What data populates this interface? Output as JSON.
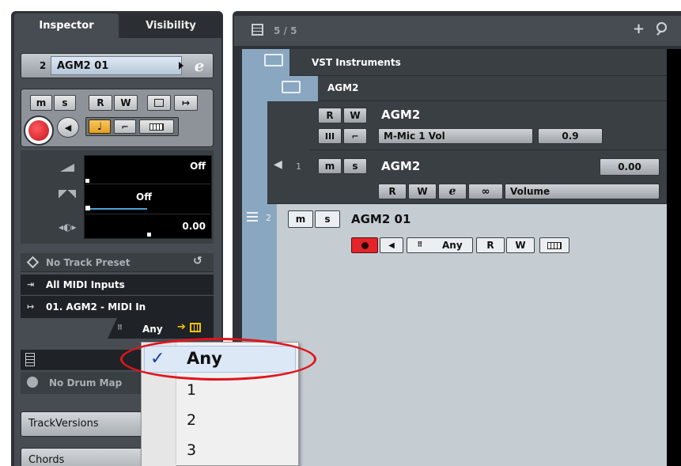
{
  "inspector": {
    "tab_inspector": "Inspector",
    "tab_visibility": "Visibility",
    "track_number": "2",
    "track_name": "AGM2 01",
    "buttons": {
      "mute": "m",
      "solo": "s",
      "read": "R",
      "write": "W"
    },
    "volume_value": "Off",
    "pan_value": "Off",
    "delay_value": "0.00",
    "track_preset": "No Track Preset",
    "midi_input": "All MIDI Inputs",
    "midi_output": "01. AGM2 - MIDI In",
    "channel": "Any",
    "drum_map": "No Drum Map",
    "section_trackversions": "TrackVersions",
    "section_chords": "Chords"
  },
  "dropdown": {
    "options": [
      "Any",
      "1",
      "2",
      "3"
    ],
    "selected": "Any"
  },
  "project": {
    "track_count": "5 / 5",
    "folder_vst": "VST Instruments",
    "folder_agm2": "AGM2",
    "instrument_track": {
      "name": "AGM2",
      "param_name": "M-Mic 1 Vol",
      "param_value": "0.9"
    },
    "audio_track": {
      "number": "1",
      "name": "AGM2",
      "volume": "0.00",
      "automation": "Volume"
    },
    "midi_track": {
      "number": "2",
      "name": "AGM2 01",
      "channel": "Any"
    }
  },
  "colors": {
    "panel_dark": "#3a3f44",
    "accent_orange": "#f0b13c",
    "record_red": "#d9202a",
    "highlight_red": "#e0141c",
    "checkmark_blue": "#1a3f9e"
  }
}
